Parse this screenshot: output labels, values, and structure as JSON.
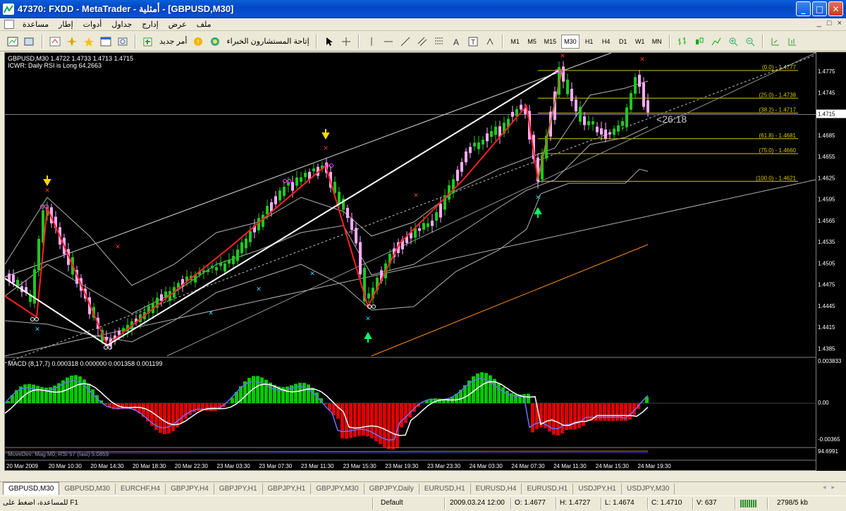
{
  "window": {
    "title": "47370: FXDD - MetaTrader - أمثلية - [GBPUSD,M30]",
    "controls": [
      "_",
      "□",
      "✕"
    ]
  },
  "menu": {
    "items": [
      "ملف",
      "عرض",
      "إدارج",
      "جداول",
      "أدوات",
      "إطار",
      "مساعدة"
    ],
    "right_controls": [
      "_",
      "□",
      "×"
    ]
  },
  "toolbar": {
    "new_order_label": "أمر جديد",
    "experts_label": "إتاحة المستشارون الخبراء",
    "timeframes": [
      "M1",
      "M5",
      "M15",
      "M30",
      "H1",
      "H4",
      "D1",
      "W1",
      "MN"
    ],
    "active_timeframe": "M30"
  },
  "chart": {
    "header_line1": "GBPUSD,M30  1.4722 1.4733 1.4713 1.4715",
    "header_line2": "ICWR: Daily RSI is Long 64.2663",
    "countdown": "<26:18",
    "current_price": "1.4715",
    "price_scale": [
      "1.4775",
      "1.4745",
      "1.4715",
      "1.4685",
      "1.4655",
      "1.4625",
      "1.4595",
      "1.4565",
      "1.4535",
      "1.4505",
      "1.4475",
      "1.4445",
      "1.4415",
      "1.4385"
    ],
    "fib_levels": [
      {
        "label": "(0.0) - 1.4777",
        "price": 1.4777
      },
      {
        "label": "(25.0) - 1.4738",
        "price": 1.4738
      },
      {
        "label": "(38.2) - 1.4717",
        "price": 1.4717
      },
      {
        "label": "(61.8) - 1.4681",
        "price": 1.4681
      },
      {
        "label": "(75.0) - 1.4660",
        "price": 1.466
      },
      {
        "label": "(100.0) - 1.4621",
        "price": 1.4621
      }
    ],
    "colors": {
      "bull": "#1ec81e",
      "bear": "#ffaaff",
      "zigzag": "#ff2020",
      "trend": "#ffffff",
      "fib": "#d8c800",
      "macd_pos": "#00c800",
      "macd_neg": "#e00000"
    }
  },
  "macd": {
    "label": "MACD (8,17,7) 0.000318 0.000000 0.001358 0.001199",
    "scale": [
      "0.003833",
      "0.00",
      "-0.00365"
    ]
  },
  "third_indicator": {
    "label": "MoveDev: Mag M0, RSI 57 (fast) 5.0859",
    "scale_label": "94.6991"
  },
  "time_axis": [
    "20 Mar 2009",
    "20 Mar 10:30",
    "20 Mar 14:30",
    "20 Mar 18:30",
    "20 Mar 22:30",
    "23 Mar 03:30",
    "23 Mar 07:30",
    "23 Mar 11:30",
    "23 Mar 15:30",
    "23 Mar 19:30",
    "23 Mar 23:30",
    "24 Mar 03:30",
    "24 Mar 07:30",
    "24 Mar 11:30",
    "24 Mar 15:30",
    "24 Mar 19:30"
  ],
  "tabs": [
    "GBPUSD,M30",
    "GBPUSD,M30",
    "EURCHF,H4",
    "GBPJPY,H4",
    "GBPJPY,H1",
    "GBPJPY,H1",
    "GBPJPY,M30",
    "GBPJPY,Daily",
    "EURUSD,H1",
    "EURUSD,H4",
    "EURUSD,H1",
    "USDJPY,H1",
    "USDJPY,M30"
  ],
  "status": {
    "help": "للمساعدة، اضغط على F1",
    "profile": "Default",
    "datetime": "2009.03.24 12:00",
    "open": "O: 1.4677",
    "high": "H: 1.4727",
    "low": "L: 1.4674",
    "close": "C: 1.4710",
    "volume": "V: 637",
    "traffic": "2798/5 kb"
  }
}
